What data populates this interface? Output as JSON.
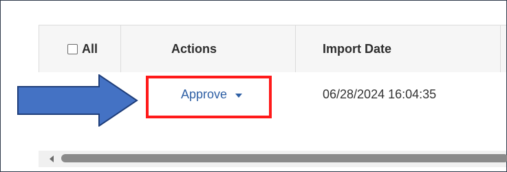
{
  "table": {
    "headers": {
      "select_all_label": "All",
      "actions": "Actions",
      "import_date": "Import Date"
    },
    "rows": [
      {
        "action_label": "Approve",
        "import_date": "06/28/2024 16:04:35"
      }
    ]
  },
  "colors": {
    "accent_link": "#2e5fa4",
    "highlight": "#ff1a1a",
    "arrow_fill": "#4472c4",
    "arrow_stroke": "#1f3e7a"
  }
}
